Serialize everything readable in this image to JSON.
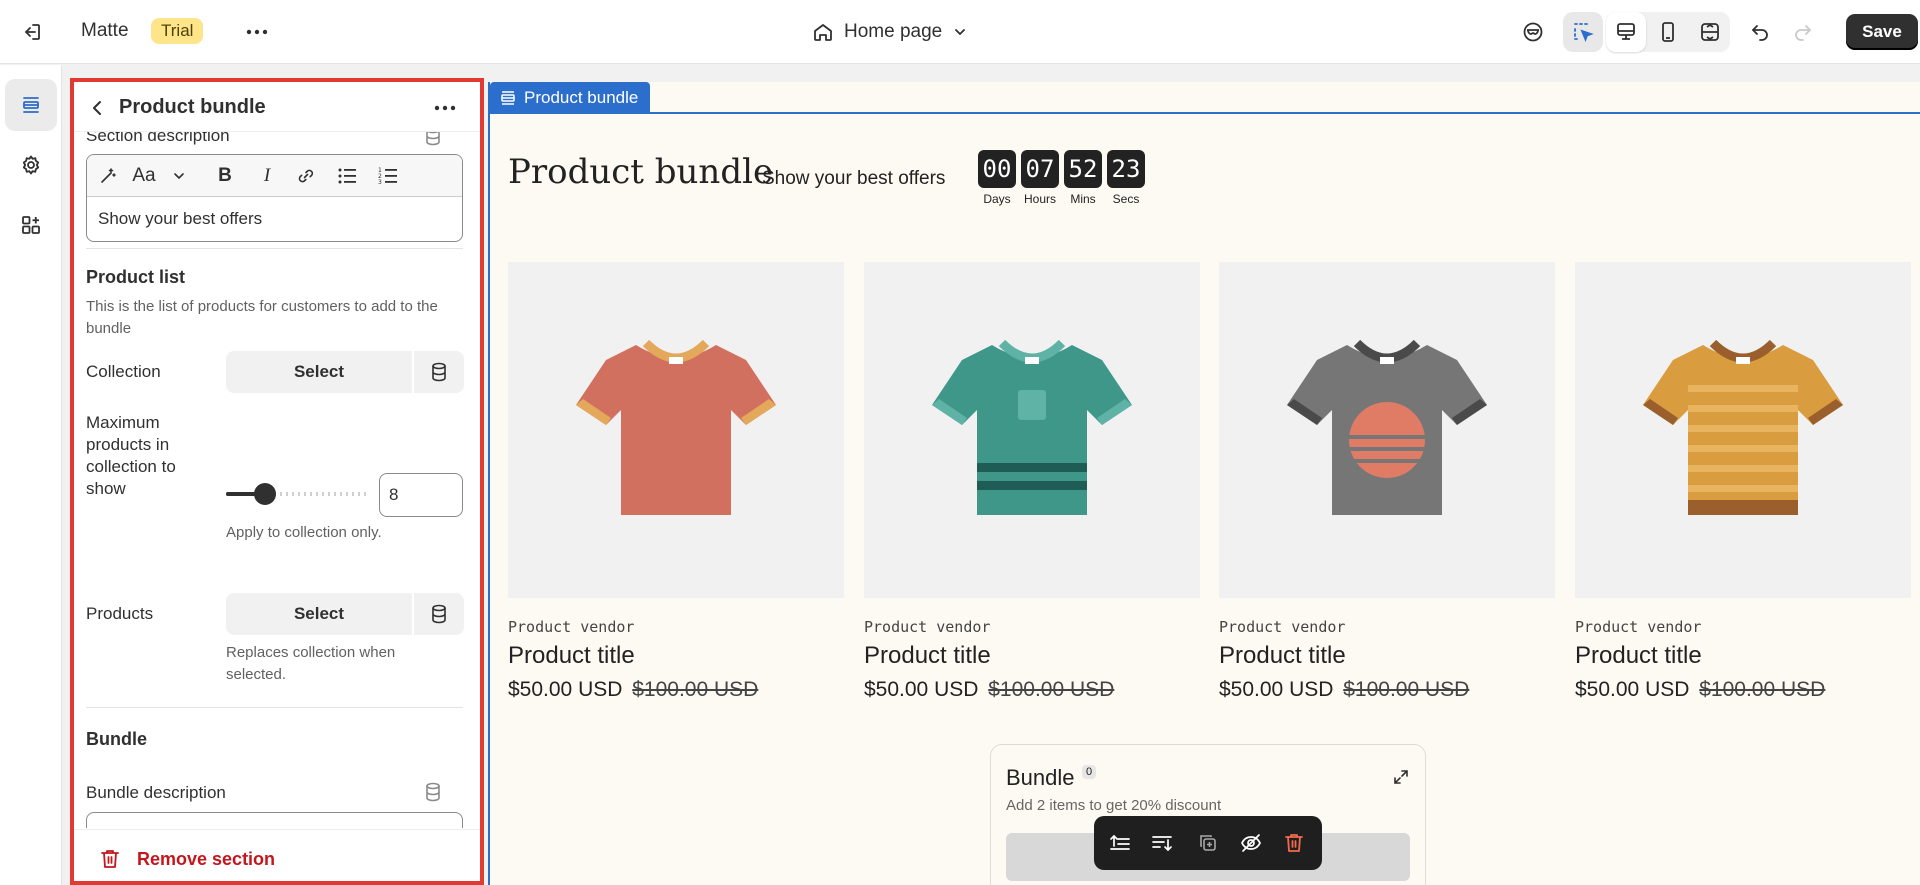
{
  "topbar": {
    "store_name": "Matte",
    "trial_badge": "Trial",
    "page_selector": "Home page",
    "save_label": "Save"
  },
  "panel": {
    "title": "Product bundle",
    "section_description_label": "Section description",
    "section_description_value": "Show your best offers",
    "product_list": {
      "heading": "Product list",
      "help": "This is the list of products for customers to add to the bundle",
      "collection_label": "Collection",
      "collection_button": "Select",
      "max_products_label": "Maximum products in collection to show",
      "max_products_value": "8",
      "max_products_help": "Apply to collection only.",
      "products_label": "Products",
      "products_button": "Select",
      "products_help": "Replaces collection when selected."
    },
    "bundle": {
      "heading": "Bundle",
      "description_label": "Bundle description",
      "description_value": "Add 2 items to get 20% discount"
    },
    "remove_label": "Remove section"
  },
  "canvas": {
    "section_tag": "Product bundle",
    "title": "Product bundle",
    "subtitle": "Show your best offers",
    "countdown": [
      {
        "value": "00",
        "unit": "Days"
      },
      {
        "value": "07",
        "unit": "Hours"
      },
      {
        "value": "52",
        "unit": "Mins"
      },
      {
        "value": "23",
        "unit": "Secs"
      }
    ],
    "products": [
      {
        "vendor": "Product vendor",
        "title": "Product title",
        "price": "$50.00 USD",
        "compare_price": "$100.00 USD",
        "shirt_color": "#d1705f",
        "trim_color": "#e3a85a"
      },
      {
        "vendor": "Product vendor",
        "title": "Product title",
        "price": "$50.00 USD",
        "compare_price": "$100.00 USD",
        "shirt_color": "#3f978a",
        "trim_color": "#5fb3a6"
      },
      {
        "vendor": "Product vendor",
        "title": "Product title",
        "price": "$50.00 USD",
        "compare_price": "$100.00 USD",
        "shirt_color": "#767676",
        "trim_color": "#4a4a4a"
      },
      {
        "vendor": "Product vendor",
        "title": "Product title",
        "price": "$50.00 USD",
        "compare_price": "$100.00 USD",
        "shirt_color": "#d99c3e",
        "trim_color": "#9a5f2c"
      }
    ],
    "bundle_box": {
      "title": "Bundle",
      "count": "0",
      "description": "Add 2 items to get 20% discount"
    }
  },
  "colors": {
    "selection_border": "#e03a32",
    "canvas_accent": "#2c6ecb",
    "trial_bg": "#ffe58a",
    "remove_text": "#c4161c"
  }
}
